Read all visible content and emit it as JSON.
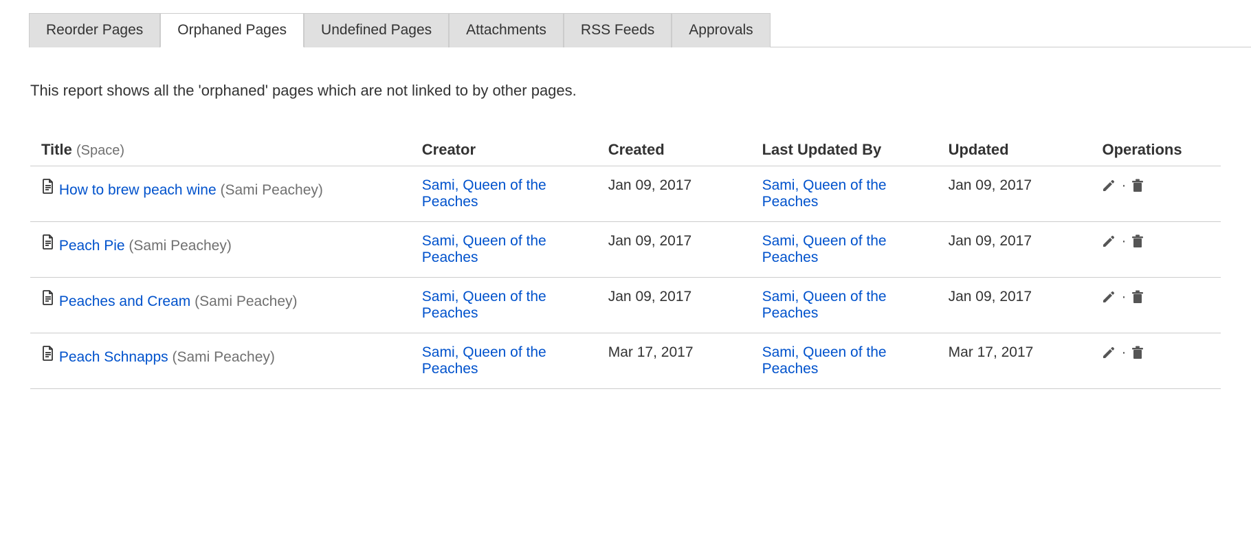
{
  "tabs": [
    {
      "label": "Reorder Pages",
      "active": false
    },
    {
      "label": "Orphaned Pages",
      "active": true
    },
    {
      "label": "Undefined Pages",
      "active": false
    },
    {
      "label": "Attachments",
      "active": false
    },
    {
      "label": "RSS Feeds",
      "active": false
    },
    {
      "label": "Approvals",
      "active": false
    }
  ],
  "description": "This report shows all the 'orphaned' pages which are not linked to by other pages.",
  "columns": {
    "title": "Title",
    "title_hint": "(Space)",
    "creator": "Creator",
    "created": "Created",
    "updated_by": "Last Updated By",
    "updated": "Updated",
    "operations": "Operations"
  },
  "rows": [
    {
      "title": "How to brew peach wine",
      "space": "(Sami Peachey)",
      "creator": "Sami, Queen of the Peaches",
      "created": "Jan 09, 2017",
      "updated_by": "Sami, Queen of the Peaches",
      "updated": "Jan 09, 2017"
    },
    {
      "title": "Peach Pie",
      "space": "(Sami Peachey)",
      "creator": "Sami, Queen of the Peaches",
      "created": "Jan 09, 2017",
      "updated_by": "Sami, Queen of the Peaches",
      "updated": "Jan 09, 2017"
    },
    {
      "title": "Peaches and Cream",
      "space": "(Sami Peachey)",
      "creator": "Sami, Queen of the Peaches",
      "created": "Jan 09, 2017",
      "updated_by": "Sami, Queen of the Peaches",
      "updated": "Jan 09, 2017"
    },
    {
      "title": "Peach Schnapps",
      "space": "(Sami Peachey)",
      "creator": "Sami, Queen of the Peaches",
      "created": "Mar 17, 2017",
      "updated_by": "Sami, Queen of the Peaches",
      "updated": "Mar 17, 2017"
    }
  ]
}
